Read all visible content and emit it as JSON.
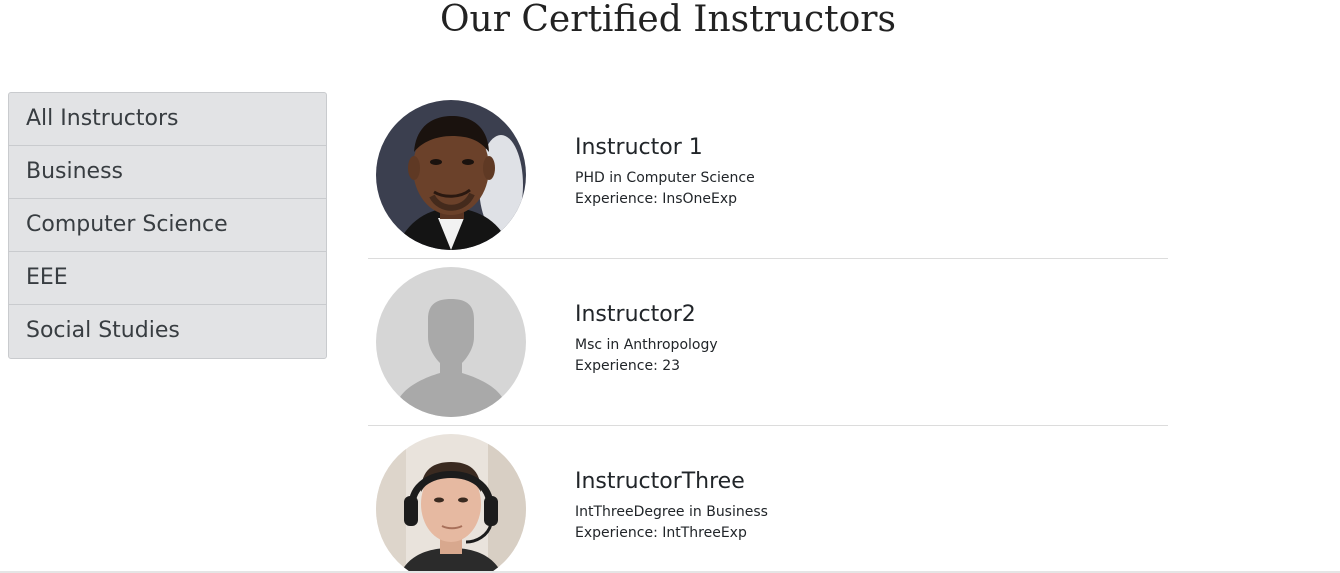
{
  "page": {
    "title": "Our Certified Instructors"
  },
  "categories": [
    {
      "label": "All Instructors"
    },
    {
      "label": "Business"
    },
    {
      "label": "Computer Science"
    },
    {
      "label": "EEE"
    },
    {
      "label": "Social Studies"
    }
  ],
  "instructors": [
    {
      "name": "Instructor 1",
      "degree": "PHD in Computer Science",
      "experience": "Experience: InsOneExp",
      "avatar": "photo"
    },
    {
      "name": "Instructor2",
      "degree": "Msc in Anthropology",
      "experience": "Experience: 23",
      "avatar": "placeholder-silhouette"
    },
    {
      "name": "InstructorThree",
      "degree": "IntThreeDegree in Business",
      "experience": "Experience: IntThreeExp",
      "avatar": "photo"
    }
  ],
  "colors": {
    "list_group_bg": "#e2e3e5",
    "list_group_text": "#383d41",
    "placeholder_bg": "#d6d6d6",
    "placeholder_figure": "#a9a9a9"
  }
}
